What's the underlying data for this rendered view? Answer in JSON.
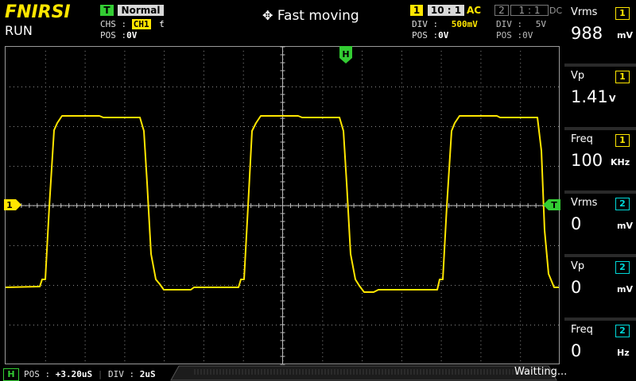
{
  "header": {
    "brand": "FNIRSI",
    "status": "RUN",
    "trigger_badge": "T",
    "trigger_mode": "Normal",
    "chs_label": "CHS :",
    "chs_value": "CH1",
    "edge_symbol": "ƭ",
    "pos_label": "POS :",
    "pos_value": "0V",
    "move_icon": "move-arrows-icon",
    "move_text": "Fast moving",
    "ch1": {
      "badge": "1",
      "probe": "10 : 1",
      "coupling": "AC",
      "div_label": "DIV :",
      "div_value": "500mV",
      "pos_label": "POS :",
      "pos_value": "0V"
    },
    "ch2": {
      "badge": "2",
      "probe": "1 : 1",
      "coupling": "DC",
      "div_label": "DIV :",
      "div_value": "5V",
      "pos_label": "POS :",
      "pos_value": "0V"
    }
  },
  "markers": {
    "h": "H",
    "ch1_level": "1",
    "trigger": "T"
  },
  "measurements": [
    {
      "label": "Vrms",
      "channel": "1",
      "value": "988",
      "unit": "mV",
      "color": "#ffe600"
    },
    {
      "label": "Vp",
      "channel": "1",
      "value": "1.41",
      "unit": "V",
      "color": "#ffe600"
    },
    {
      "label": "Freq",
      "channel": "1",
      "value": "100",
      "unit": "KHz",
      "color": "#ffe600"
    },
    {
      "label": "Vrms",
      "channel": "2",
      "value": "0",
      "unit": "mV",
      "color": "#00d8d8"
    },
    {
      "label": "Vp",
      "channel": "2",
      "value": "0",
      "unit": "mV",
      "color": "#00d8d8"
    },
    {
      "label": "Freq",
      "channel": "2",
      "value": "0",
      "unit": "Hz",
      "color": "#00d8d8"
    }
  ],
  "bottom": {
    "h_badge": "H",
    "pos_label": "POS :",
    "pos_value": "+3.20uS",
    "div_label": "DIV :",
    "div_value": "2uS",
    "status": "Waitting..."
  },
  "colors": {
    "trace": "#ffe600",
    "grid": "#8a8a8a",
    "ch2": "#00d8d8",
    "trigger": "#33cc33"
  }
}
